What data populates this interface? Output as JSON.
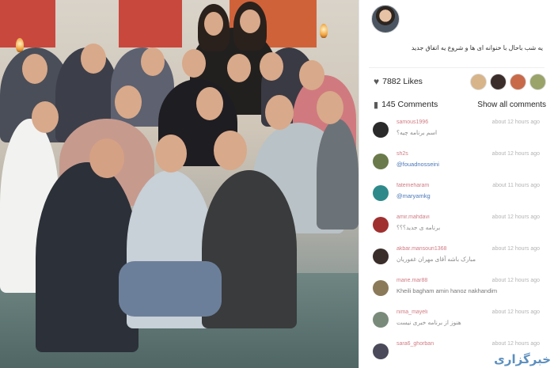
{
  "post": {
    "caption": "یه شب باحال با خنوانه ای ها و شروع یه اتفاق جدید",
    "likes_label": "7882 Likes",
    "comments_label": "145 Comments",
    "show_all_label": "Show all comments"
  },
  "likers": [
    {
      "color": "#d8b48a"
    },
    {
      "color": "#3b2e2a"
    },
    {
      "color": "#c86a4a"
    },
    {
      "color": "#9aa36a"
    }
  ],
  "comments": [
    {
      "user": "samous1996",
      "time": "about 12 hours ago",
      "text": "اسم برنامه چیه؟",
      "avatar": "#2a2a2a",
      "style": "plain"
    },
    {
      "user": "sh2s",
      "time": "about 12 hours ago",
      "text": "@fouadnosseini",
      "avatar": "#6a7a4a",
      "style": "mention"
    },
    {
      "user": "fatemeharam",
      "time": "about 11 hours ago",
      "text": "@maryamkg",
      "avatar": "#2e8a8a",
      "style": "mention"
    },
    {
      "user": "amir.mahdavi",
      "time": "about 12 hours ago",
      "text": "برنامه ی جدید؟؟؟",
      "avatar": "#a03030",
      "style": "plain"
    },
    {
      "user": "akbar.mansouri1368",
      "time": "about 12 hours ago",
      "text": "مبارک باشه آقای مهران غفوریان",
      "avatar": "#3a2e2a",
      "style": "plain"
    },
    {
      "user": "marie.mar88",
      "time": "about 12 hours ago",
      "text": "Kheili bagham amin hanoz nakhandim",
      "avatar": "#8a7a5a",
      "style": "dark"
    },
    {
      "user": "nima_mayeli",
      "time": "about 12 hours ago",
      "text": "هنوز از برنامه خبری نیست",
      "avatar": "#7a8a7a",
      "style": "plain"
    },
    {
      "user": "sara6_ghorban",
      "time": "about 12 hours ago",
      "text": "",
      "avatar": "#4a4a5a",
      "style": "plain"
    }
  ],
  "watermark": "خبرگزاری"
}
